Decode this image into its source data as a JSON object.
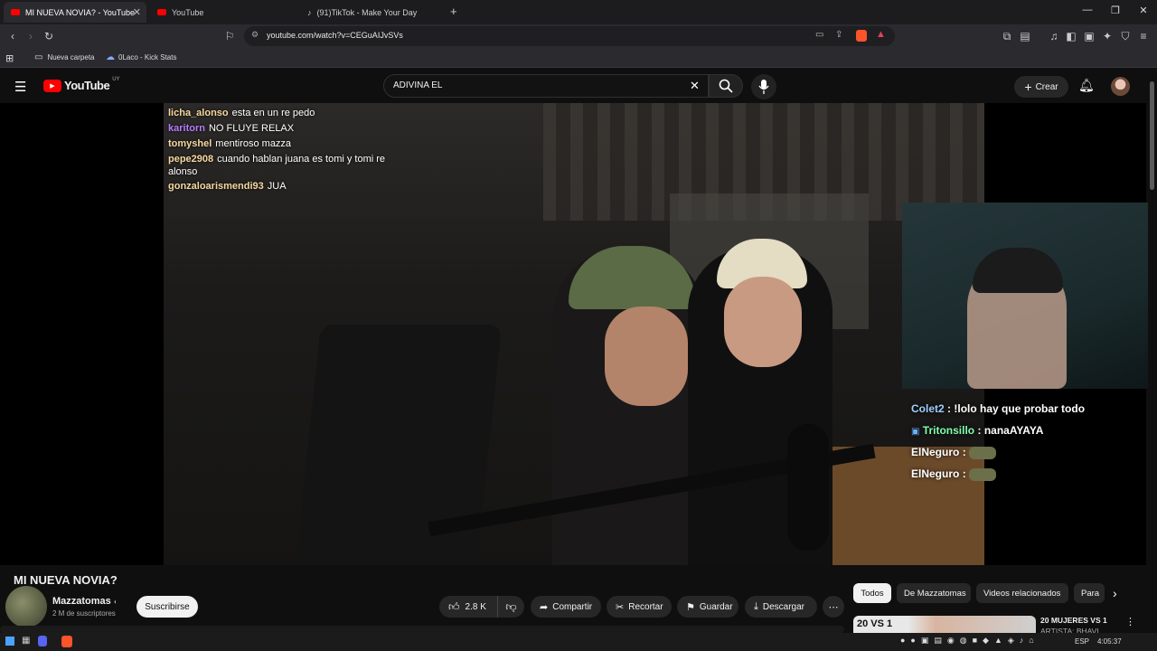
{
  "browser": {
    "tabs": [
      {
        "label": "MI NUEVA NOVIA? - YouTube",
        "active": true
      },
      {
        "label": "YouTube",
        "active": false
      },
      {
        "label": "(91)TikTok - Make Your Day",
        "active": false
      }
    ],
    "url": "youtube.com/watch?v=CEGuAIJvSVs",
    "bookmarks": [
      {
        "label": "Nueva carpeta"
      },
      {
        "label": "0Laco - Kick Stats"
      }
    ]
  },
  "youtube": {
    "logo_text": "YouTube",
    "region": "UY",
    "search_value": "ADIVINA EL",
    "create_label": "Crear"
  },
  "stream_chat": [
    {
      "user": "licha_alonso",
      "text": "esta en un re pedo",
      "color": "#f6d7a0"
    },
    {
      "user": "karitorn",
      "text": "NO FLUYE RELAX",
      "color": "#b77bff"
    },
    {
      "user": "tomyshel",
      "text": "mentiroso mazza",
      "color": "#f6d7a0"
    },
    {
      "user": "pepe2908",
      "text": "cuando hablan juana es tomi y tomi re alonso",
      "color": "#f6d7a0"
    },
    {
      "user": "gonzaloarismendi93",
      "text": "JUA",
      "color": "#f6d7a0"
    }
  ],
  "overlay_chat": [
    {
      "user": "Colet2",
      "text": ": !lolo hay que probar todo",
      "color": "#9fd0ff"
    },
    {
      "user": "Tritonsillo",
      "text": ": nanaAYAYA",
      "color": "#7fffb0"
    },
    {
      "user": "ElNeguro",
      "text": ":",
      "color": "#ffffff"
    },
    {
      "user": "ElNeguro",
      "text": ":",
      "color": "#ffffff"
    }
  ],
  "video": {
    "title": "MI NUEVA NOVIA?",
    "channel": "Mazzatomas",
    "subscribers": "2 M de suscriptores",
    "subscribe_label": "Suscribirse",
    "likes": "2.8 K",
    "share_label": "Compartir",
    "clip_label": "Recortar",
    "save_label": "Guardar",
    "download_label": "Descargar"
  },
  "chips": [
    {
      "label": "Todos",
      "selected": true
    },
    {
      "label": "De Mazzatomas",
      "selected": false
    },
    {
      "label": "Videos relacionados",
      "selected": false
    },
    {
      "label": "Para",
      "selected": false
    }
  ],
  "recommendation": {
    "thumb_text": "20 VS 1",
    "title_line1": "20 MUJERES VS 1",
    "title_line2": "ARTISTA: BHAVI..."
  },
  "taskbar": {
    "lang": "ESP",
    "time": "4:05:37"
  },
  "colors": {
    "yt_red": "#ff0000",
    "accent": "#3ea6ff"
  }
}
